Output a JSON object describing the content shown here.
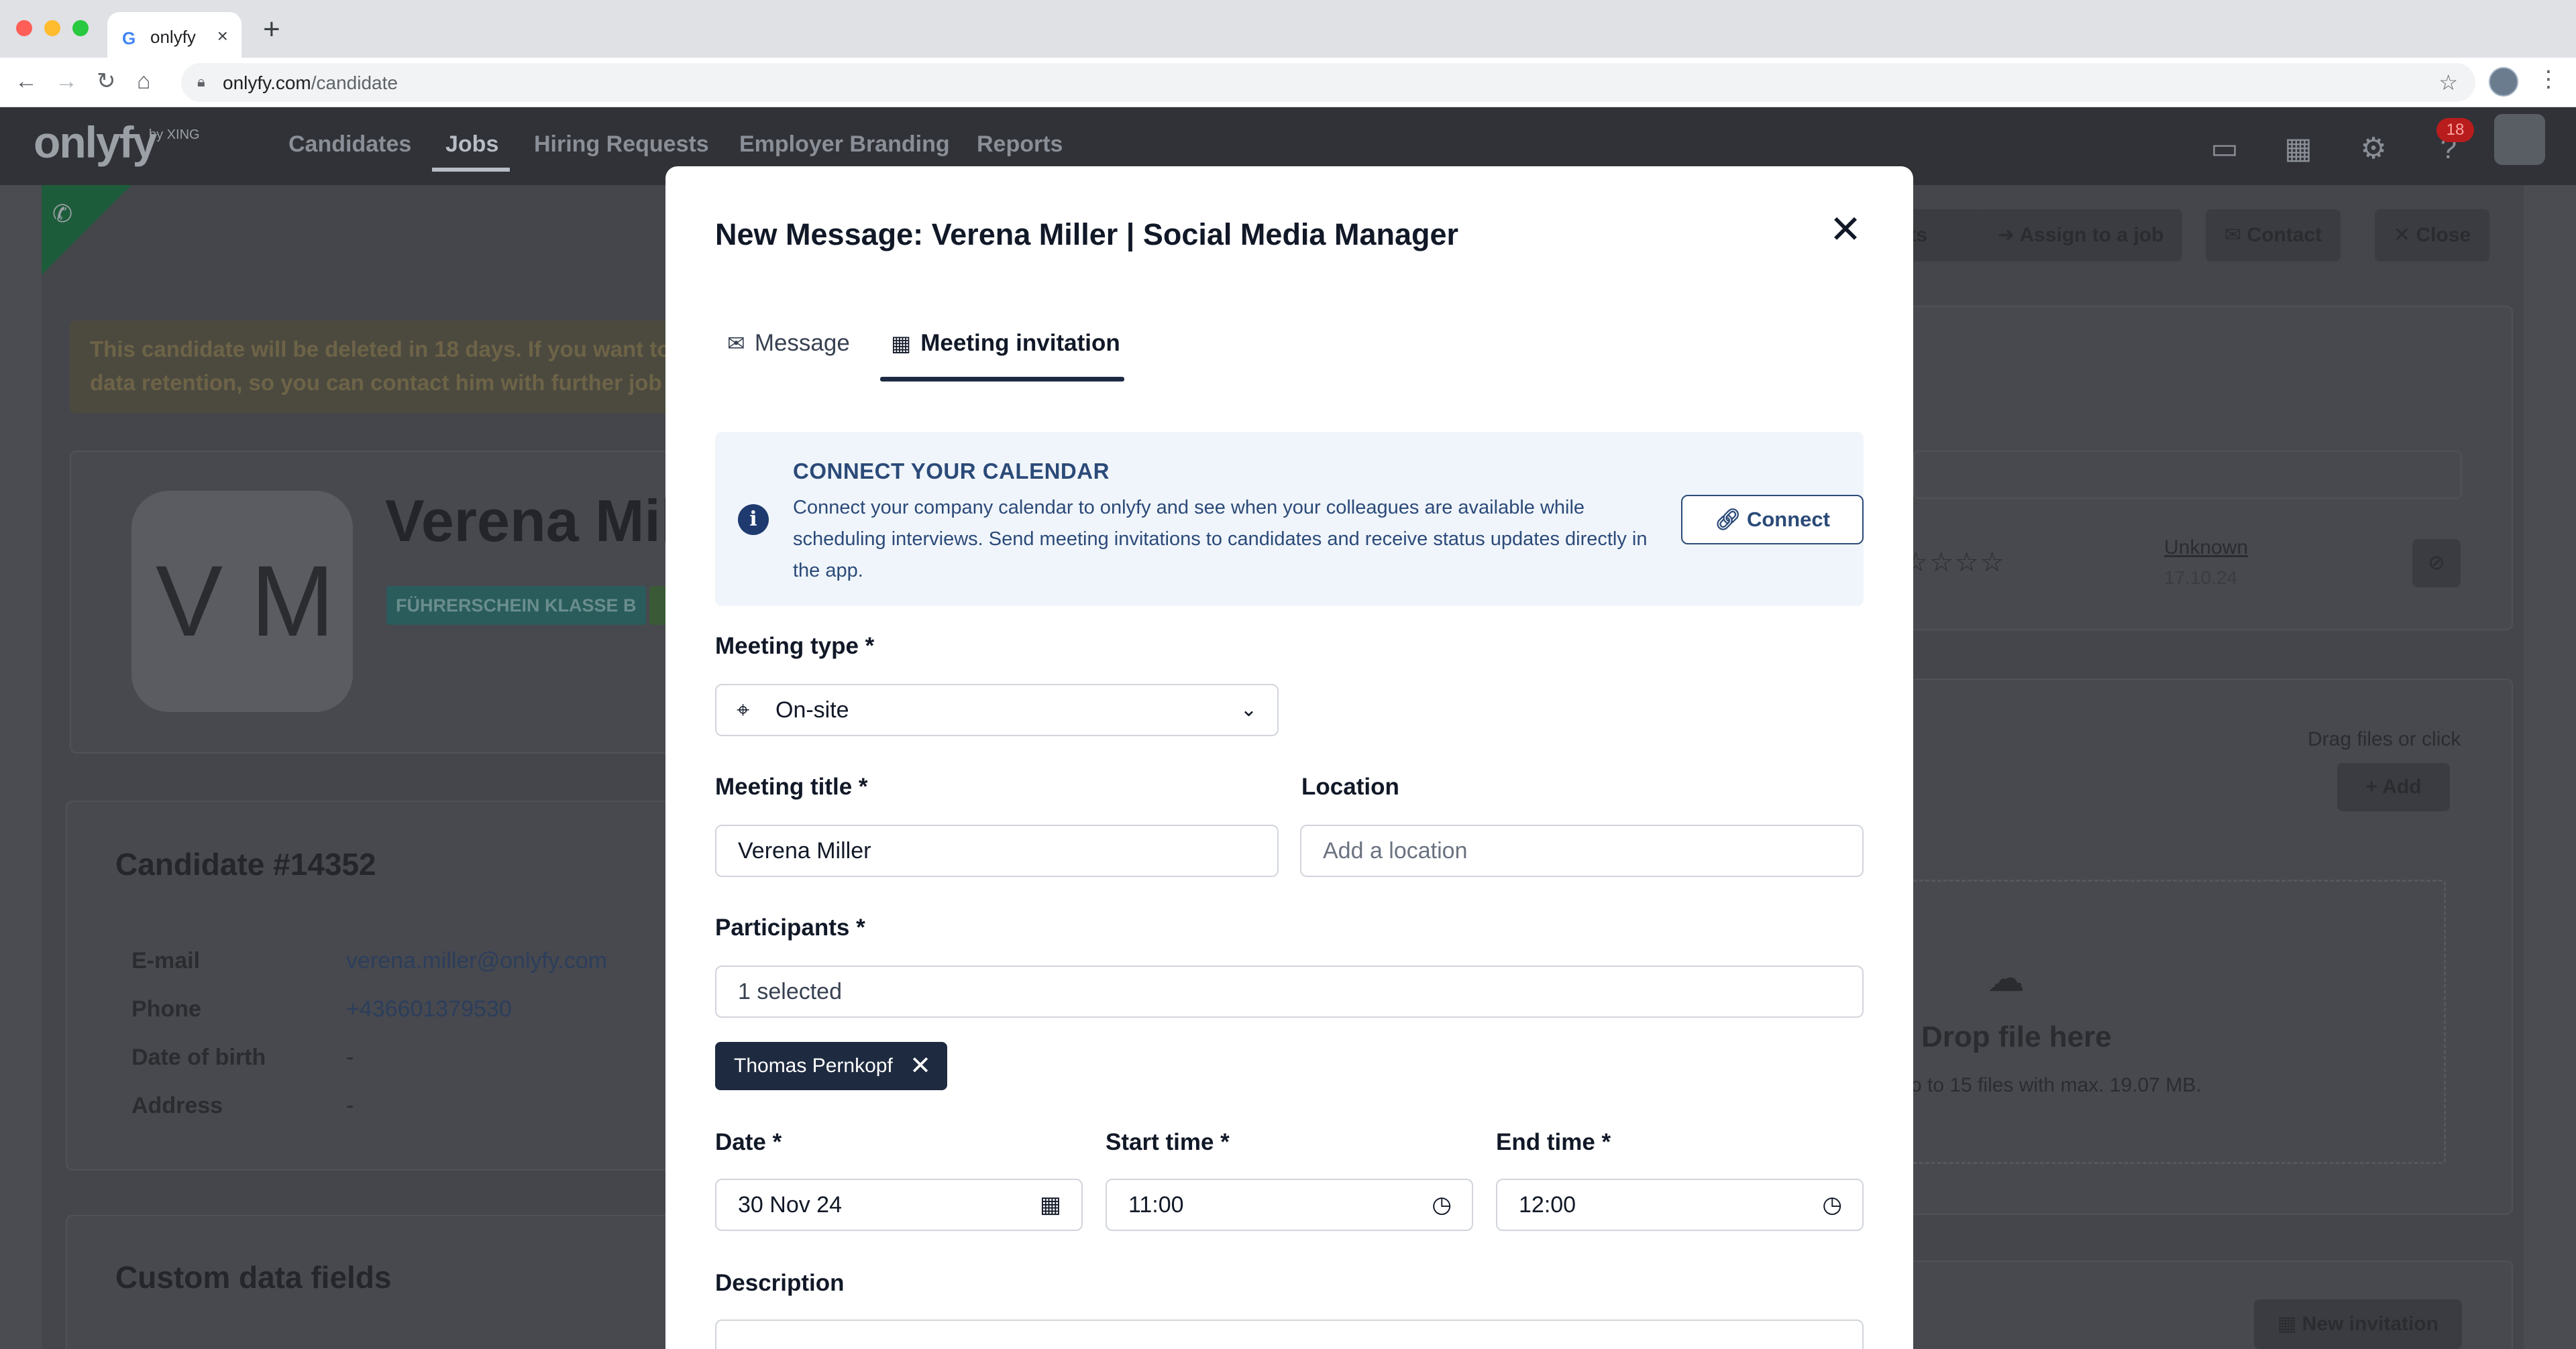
{
  "browser": {
    "tab_title": "onlyfy",
    "url_host": "onlyfy.com",
    "url_path": "/candidate"
  },
  "header": {
    "logo": "onlyfy",
    "logo_by": "by XING",
    "nav": [
      {
        "label": "Candidates",
        "active": false
      },
      {
        "label": "Jobs",
        "active": true
      },
      {
        "label": "Hiring Requests",
        "active": false
      },
      {
        "label": "Employer Branding",
        "active": false
      },
      {
        "label": "Reports",
        "active": false
      }
    ],
    "notification_count": "18"
  },
  "background": {
    "warning": "This candidate will be deleted in 18 days. If you want to data retention, so you can contact him with further job",
    "initials": "V M",
    "name": "Verena Mil",
    "tag": "FÜHRERSCHEIN KLASSE B",
    "candidate_heading": "Candidate #14352",
    "fields": [
      {
        "label": "E-mail",
        "value": "verena.miller@onlyfy.com",
        "link": true
      },
      {
        "label": "Phone",
        "value": "+436601379530",
        "link": true
      },
      {
        "label": "Date of birth",
        "value": "-",
        "link": false
      },
      {
        "label": "Address",
        "value": "-",
        "link": false
      }
    ],
    "custom_heading": "Custom data fields",
    "actions": {
      "partial": "nts",
      "assign": "Assign to a job",
      "contact": "Contact",
      "close": "Close"
    },
    "rating_status": "Unknown",
    "rating_date": "17.10.24",
    "drag_text": "Drag files or click",
    "add_label": "Add",
    "drop_title": "Drop file here",
    "drop_sub": "o to 15 files with max. 19.07 MB.",
    "new_invitation": "New invitation"
  },
  "modal": {
    "title": "New Message: Verena Miller | Social Media Manager",
    "tabs": [
      {
        "label": "Message",
        "icon": "mail-icon",
        "active": false
      },
      {
        "label": "Meeting invitation",
        "icon": "calendar-icon",
        "active": true
      }
    ],
    "calendar_notice": {
      "title": "CONNECT YOUR CALENDAR",
      "text": "Connect your company calendar to onlyfy and see when your colleagues are available while scheduling interviews. Send meeting invitations to candidates and receive status updates directly in the app.",
      "button": "Connect"
    },
    "meeting_type": {
      "label": "Meeting type *",
      "value": "On-site"
    },
    "meeting_title": {
      "label": "Meeting title *",
      "value": "Verena Miller"
    },
    "location": {
      "label": "Location",
      "placeholder": "Add a location"
    },
    "participants": {
      "label": "Participants *",
      "value": "1 selected",
      "chips": [
        "Thomas Pernkopf"
      ]
    },
    "date": {
      "label": "Date *",
      "value": "30 Nov 24"
    },
    "start_time": {
      "label": "Start time *",
      "value": "11:00"
    },
    "end_time": {
      "label": "End time *",
      "value": "12:00"
    },
    "description": {
      "label": "Description"
    }
  },
  "colors": {
    "brand_navy": "#1e2a44",
    "info_bg": "#f0f5fb",
    "info_text": "#2b4a78",
    "overlay": "#4a4c52"
  }
}
